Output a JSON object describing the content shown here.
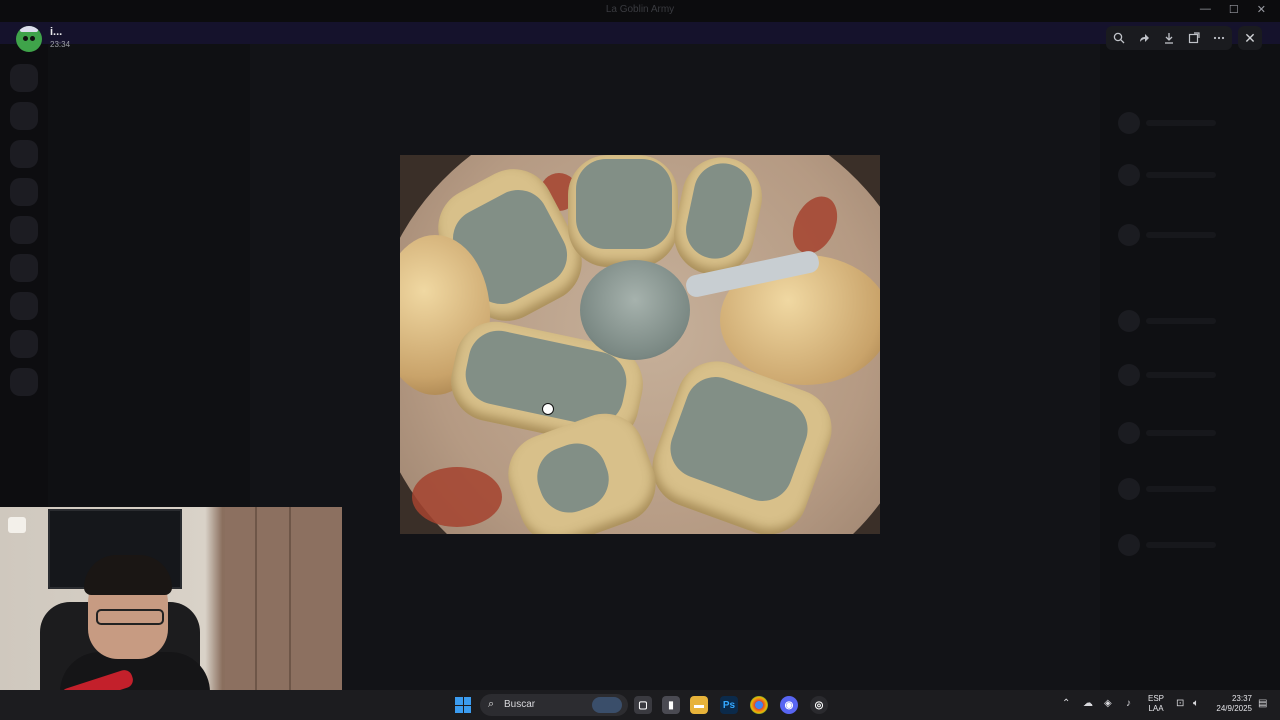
{
  "window": {
    "title": "La Goblin Army"
  },
  "viewer": {
    "author": "i...",
    "timestamp": "23:34",
    "tools": {
      "zoom": "zoom-in-icon",
      "forward": "forward-icon",
      "download": "download-icon",
      "open": "open-external-icon",
      "more": "more-icon"
    },
    "close_glyph": "✕"
  },
  "taskbar": {
    "search_placeholder": "Buscar",
    "language": {
      "line1": "ESP",
      "line2": "LAA"
    },
    "clock": {
      "time": "23:37",
      "date": "24/9/2025"
    },
    "apps": [
      "file-explorer-icon",
      "photoshop-icon",
      "chrome-icon",
      "discord-icon",
      "obs-icon"
    ]
  }
}
